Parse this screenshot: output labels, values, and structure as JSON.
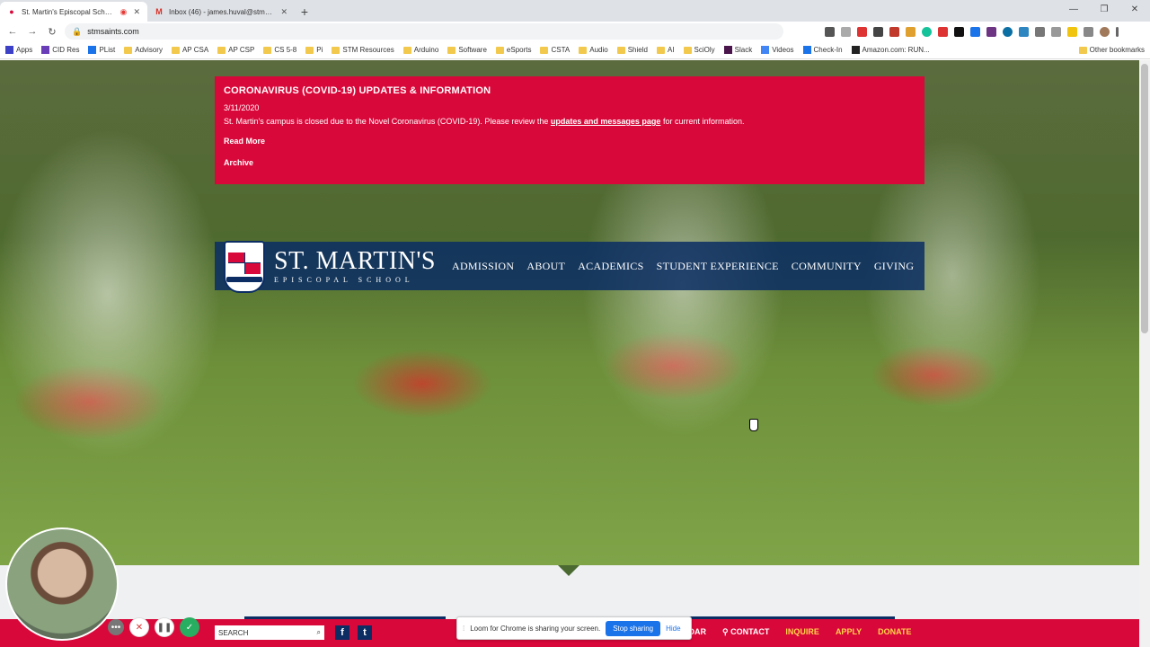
{
  "browser": {
    "tabs": [
      {
        "title": "St. Martin's Episcopal Scho...",
        "active": true
      },
      {
        "title": "Inbox (46) - james.huval@stmsai...",
        "active": false
      }
    ],
    "url": "stmsaints.com",
    "bookmarks": [
      "Apps",
      "CID Res",
      "PList",
      "Advisory",
      "AP CSA",
      "AP CSP",
      "CS 5-8",
      "Pi",
      "STM Resources",
      "Arduino",
      "Software",
      "eSports",
      "CSTA",
      "Audio",
      "Shield",
      "AI",
      "SciOly",
      "Slack",
      "Videos",
      "Check-In",
      "Amazon.com: RUN..."
    ],
    "other_bookmarks": "Other bookmarks"
  },
  "alert": {
    "heading": "CORONAVIRUS (COVID-19) UPDATES & INFORMATION",
    "date": "3/11/2020",
    "message_before": "St. Martin's campus is closed due to the Novel Coronavirus (COVID-19). Please review the",
    "message_link": "updates and messages page",
    "message_after": "for current information.",
    "read_more": "Read More",
    "archive": "Archive"
  },
  "brand": {
    "name": "ST. MARTIN'S",
    "sub": "EPISCOPAL SCHOOL"
  },
  "menu": [
    "ADMISSION",
    "ABOUT",
    "ACADEMICS",
    "STUDENT EXPERIENCE",
    "COMMUNITY",
    "GIVING"
  ],
  "footer": {
    "search_placeholder": "SEARCH",
    "social": [
      "f",
      "t"
    ],
    "links": [
      "NDAR",
      "CONTACT",
      "INQUIRE",
      "APPLY",
      "DONATE"
    ]
  },
  "loom": {
    "text": "Loom for Chrome is sharing your screen.",
    "stop": "Stop sharing",
    "hide": "Hide"
  },
  "colors": {
    "accent": "#d9083a",
    "navy": "#0b2d64"
  }
}
